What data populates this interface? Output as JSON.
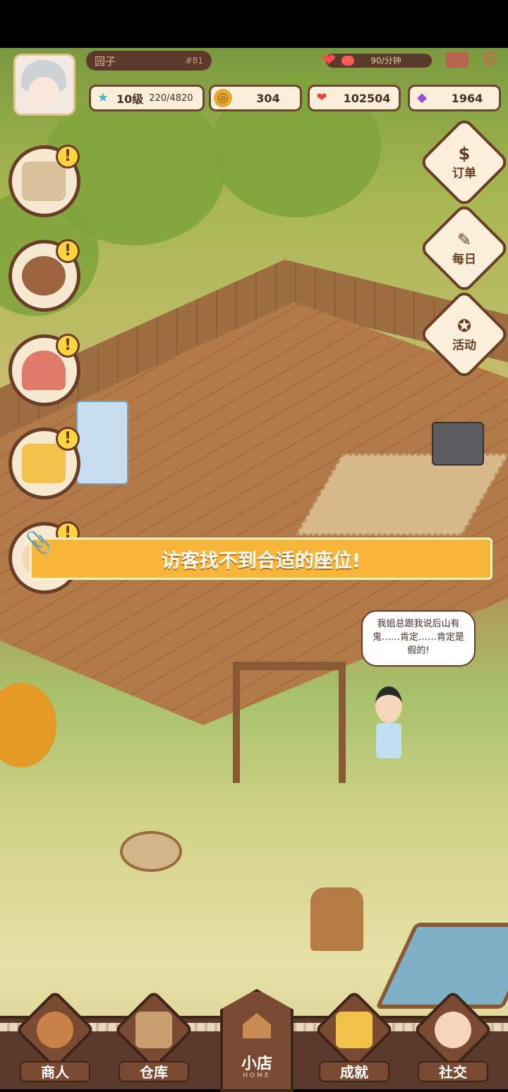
{
  "header": {
    "player_name": "园子",
    "player_id": "#81",
    "hp_rate": "90/分钟",
    "level_label": "10级",
    "xp": "220/4820"
  },
  "resources": {
    "coins": "304",
    "hearts": "102504",
    "gems": "1964"
  },
  "colors": {
    "banner": "#f7b53a",
    "panel": "#fbeeda",
    "border": "#6a3e26",
    "hp": "#ff5a5a"
  },
  "left_buttons": [
    {
      "name": "tofu-task",
      "alert": "!"
    },
    {
      "name": "pottery-task",
      "alert": "!"
    },
    {
      "name": "squid-task",
      "alert": "!"
    },
    {
      "name": "video-ad",
      "alert": "!"
    },
    {
      "name": "visitor-task",
      "alert": "!"
    }
  ],
  "right_buttons": [
    {
      "label": "订单",
      "icon": "order-book-icon"
    },
    {
      "label": "每日",
      "icon": "daily-checklist-icon"
    },
    {
      "label": "活动",
      "icon": "event-badge-icon"
    }
  ],
  "notification": {
    "message": "访客找不到合适的座位!"
  },
  "visitor_speech": "我姐总跟我说后山有鬼……肯定……肯定是假的!",
  "bottom_nav": {
    "items": [
      {
        "label": "商人"
      },
      {
        "label": "仓库"
      },
      {
        "label": "成就"
      },
      {
        "label": "社交"
      }
    ],
    "home_label": "小店",
    "home_sub": "HOME"
  }
}
